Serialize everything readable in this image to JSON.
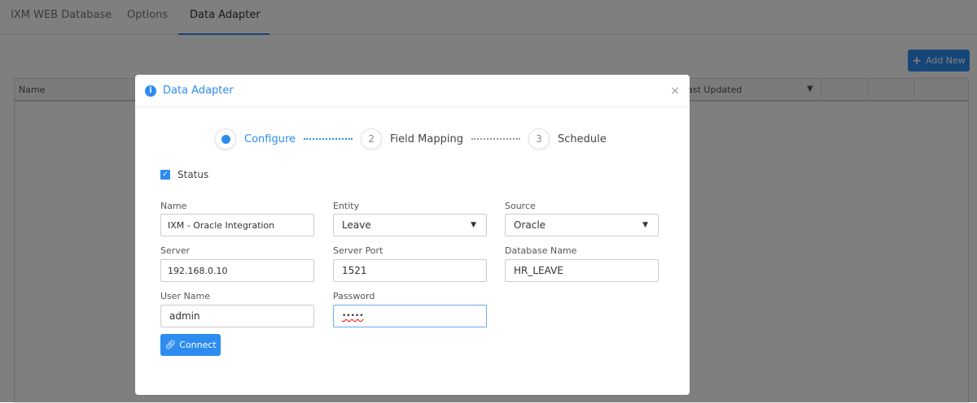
{
  "tabs": [
    {
      "label": "IXM WEB Database"
    },
    {
      "label": "Options"
    },
    {
      "label": "Data Adapter",
      "active": true
    }
  ],
  "toolbar": {
    "add_new_label": "Add New",
    "add_icon": "plus-icon"
  },
  "table": {
    "columns": [
      "Name",
      "Last Updated",
      "",
      "",
      ""
    ],
    "filter_icon": "filter-icon"
  },
  "modal": {
    "title": "Data Adapter",
    "info_icon": "info-icon",
    "close_icon": "close-icon",
    "close_label": "×",
    "steps": [
      {
        "number": "1",
        "label": "Configure",
        "active": true
      },
      {
        "number": "2",
        "label": "Field Mapping"
      },
      {
        "number": "3",
        "label": "Schedule"
      }
    ],
    "status": {
      "label": "Status",
      "checked": true
    },
    "fields": {
      "name": {
        "label": "Name",
        "value": "IXM - Oracle Integration"
      },
      "entity": {
        "label": "Entity",
        "value": "Leave"
      },
      "source": {
        "label": "Source",
        "value": "Oracle"
      },
      "server": {
        "label": "Server",
        "value": "192.168.0.10"
      },
      "server_port": {
        "label": "Server Port",
        "value": "1521"
      },
      "database_name": {
        "label": "Database Name",
        "value": "HR_LEAVE"
      },
      "user_name": {
        "label": "User Name",
        "value": "admin"
      },
      "password": {
        "label": "Password",
        "value": "•••••"
      }
    },
    "connect_label": "Connect",
    "connect_icon": "link-icon"
  },
  "colors": {
    "accent": "#2d8cf0"
  }
}
